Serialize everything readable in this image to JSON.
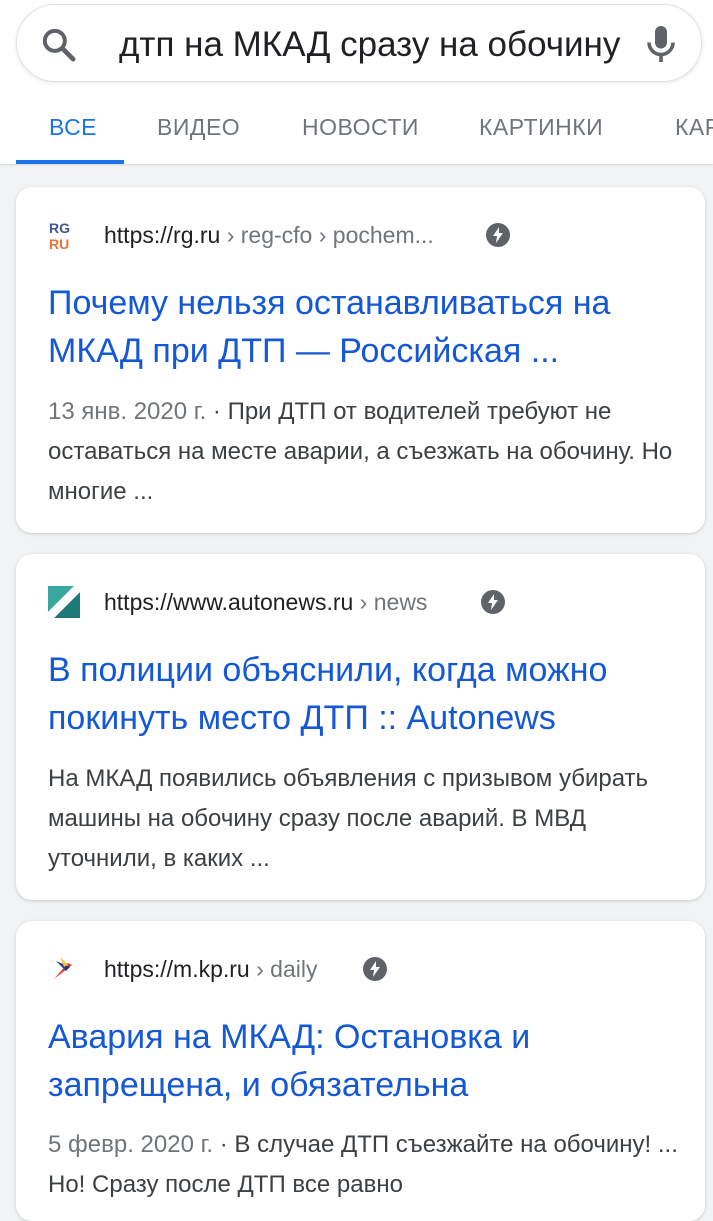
{
  "search": {
    "query": "дтп на МКАД сразу на обочину"
  },
  "tabs": [
    {
      "label": "ВСЕ",
      "active": true
    },
    {
      "label": "ВИДЕО"
    },
    {
      "label": "НОВОСТИ"
    },
    {
      "label": "КАРТИНКИ"
    },
    {
      "label": "КАРТЫ"
    }
  ],
  "results": [
    {
      "url_host": "https://rg.ru",
      "url_path": " › reg-cfo › pochem...",
      "title": "Почему нельзя останавливаться на МКАД при ДТП — Российская ...",
      "date": "13 янв. 2020 г.",
      "snippet": " · При ДТП от водителей требуют не оставаться на месте аварии, а съезжать на обочину. Но многие ...",
      "favicon": "rg-ru-logo"
    },
    {
      "url_host": "https://www.autonews.ru",
      "url_path": " › news",
      "title": "В полиции объяснили, когда можно покинуть место ДТП :: Autonews",
      "date": "",
      "snippet": "На МКАД появились объявления с призывом убирать машины на обочину сразу после аварий. В МВД уточнили, в каких ...",
      "favicon": "autonews-logo"
    },
    {
      "url_host": "https://m.kp.ru",
      "url_path": " › daily",
      "title": "Авария на МКАД: Остановка и запрещена, и обязательна",
      "date": "5 февр. 2020 г.",
      "snippet": " · В случае ДТП съезжайте на обочину! ... Но! Сразу после ДТП все равно",
      "favicon": "kp-ru-logo"
    }
  ],
  "colors": {
    "accent": "#1a73e8",
    "title_link": "#1558d6",
    "background": "#f1f3f4"
  }
}
